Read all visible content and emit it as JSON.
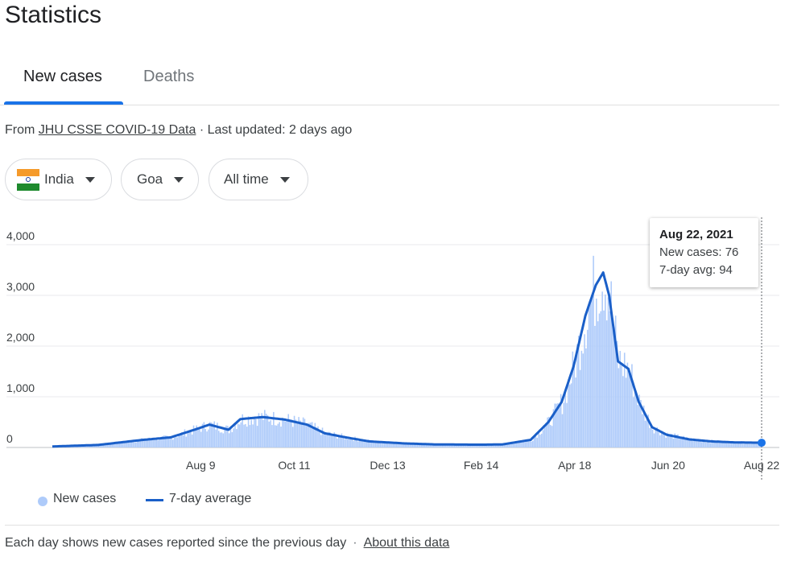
{
  "page_title": "Statistics",
  "tabs": [
    {
      "label": "New cases",
      "active": true
    },
    {
      "label": "Deaths",
      "active": false
    }
  ],
  "source": {
    "prefix": "From ",
    "link": "JHU CSSE COVID-19 Data",
    "suffix": " · Last updated: 2 days ago"
  },
  "filters": {
    "country": "India",
    "region": "Goa",
    "range": "All time"
  },
  "tooltip": {
    "date": "Aug 22, 2021",
    "new_cases": "New cases: 76",
    "avg": "7-day avg: 94"
  },
  "legend": {
    "bars": "New cases",
    "line": "7-day average"
  },
  "footer": {
    "note": "Each day shows new cases reported since the previous day",
    "link": "About this data"
  },
  "colors": {
    "bar": "#aecbfa",
    "line": "#1a5fc8",
    "accent": "#1a73e8",
    "grid": "#e8eaed"
  },
  "chart_data": {
    "type": "bar",
    "title": "",
    "xlabel": "",
    "ylabel": "",
    "ylim": [
      0,
      4000
    ],
    "y_ticks": [
      0,
      1000,
      2000,
      3000,
      4000
    ],
    "y_tick_labels": [
      "0",
      "1,000",
      "2,000",
      "3,000",
      "4,000"
    ],
    "x_range": [
      "2020-05-01",
      "2021-08-22"
    ],
    "x_ticks": [
      {
        "date": "2020-08-09",
        "label": "Aug 9"
      },
      {
        "date": "2020-10-11",
        "label": "Oct 11"
      },
      {
        "date": "2020-12-13",
        "label": "Dec 13"
      },
      {
        "date": "2021-02-14",
        "label": "Feb 14"
      },
      {
        "date": "2021-04-18",
        "label": "Apr 18"
      },
      {
        "date": "2021-06-20",
        "label": "Jun 20"
      },
      {
        "date": "2021-08-22",
        "label": "Aug 22"
      }
    ],
    "series": [
      {
        "name": "New cases",
        "kind": "bar"
      },
      {
        "name": "7-day average",
        "kind": "line"
      }
    ],
    "key_points": [
      {
        "date": "2020-05-01",
        "avg": 20
      },
      {
        "date": "2020-06-01",
        "avg": 50
      },
      {
        "date": "2020-07-01",
        "avg": 150
      },
      {
        "date": "2020-07-20",
        "avg": 200
      },
      {
        "date": "2020-08-05",
        "avg": 350
      },
      {
        "date": "2020-08-15",
        "avg": 450
      },
      {
        "date": "2020-08-28",
        "avg": 350
      },
      {
        "date": "2020-09-05",
        "avg": 560
      },
      {
        "date": "2020-09-20",
        "avg": 600
      },
      {
        "date": "2020-10-05",
        "avg": 550
      },
      {
        "date": "2020-10-20",
        "avg": 450
      },
      {
        "date": "2020-11-01",
        "avg": 280
      },
      {
        "date": "2020-11-15",
        "avg": 200
      },
      {
        "date": "2020-12-01",
        "avg": 120
      },
      {
        "date": "2020-12-13",
        "avg": 100
      },
      {
        "date": "2020-12-25",
        "avg": 80
      },
      {
        "date": "2021-01-15",
        "avg": 60
      },
      {
        "date": "2021-02-14",
        "avg": 55
      },
      {
        "date": "2021-03-01",
        "avg": 60
      },
      {
        "date": "2021-03-20",
        "avg": 150
      },
      {
        "date": "2021-04-01",
        "avg": 500
      },
      {
        "date": "2021-04-10",
        "avg": 900
      },
      {
        "date": "2021-04-18",
        "avg": 1600
      },
      {
        "date": "2021-04-26",
        "avg": 2600
      },
      {
        "date": "2021-05-03",
        "avg": 3200
      },
      {
        "date": "2021-05-08",
        "avg": 3450
      },
      {
        "date": "2021-05-12",
        "avg": 3000
      },
      {
        "date": "2021-05-18",
        "avg": 1700
      },
      {
        "date": "2021-05-25",
        "avg": 1550
      },
      {
        "date": "2021-06-01",
        "avg": 900
      },
      {
        "date": "2021-06-10",
        "avg": 400
      },
      {
        "date": "2021-06-20",
        "avg": 250
      },
      {
        "date": "2021-07-05",
        "avg": 160
      },
      {
        "date": "2021-07-20",
        "avg": 120
      },
      {
        "date": "2021-08-05",
        "avg": 100
      },
      {
        "date": "2021-08-22",
        "avg": 94
      }
    ],
    "highlight": {
      "date": "2021-08-22",
      "new_cases": 76,
      "avg": 94
    }
  }
}
